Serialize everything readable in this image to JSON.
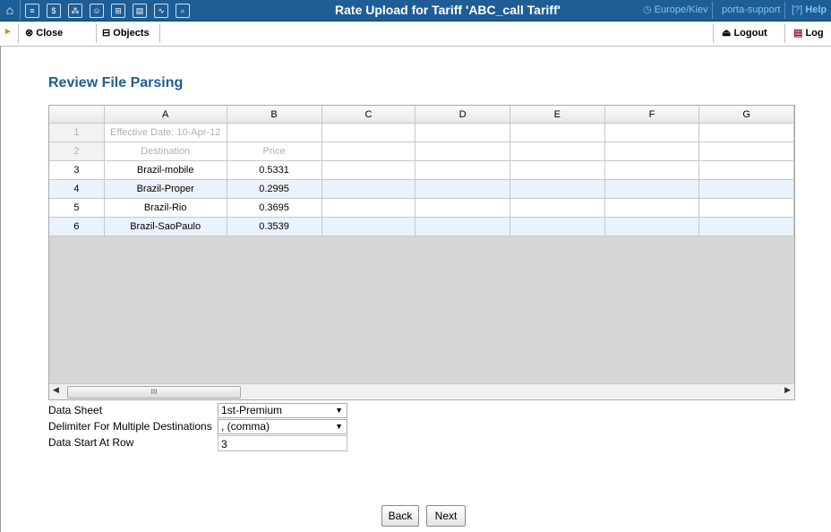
{
  "header": {
    "title": "Rate Upload for Tariff 'ABC_call Tariff'",
    "timezone": "Europe/Kiev",
    "user": "porta-support",
    "help": "Help",
    "icons": [
      "home-icon",
      "list-icon",
      "dollar-icon",
      "network-icon",
      "person-icon",
      "grid-icon",
      "report-icon",
      "chart-icon",
      "search-icon"
    ]
  },
  "toolbar": {
    "close": "Close",
    "objects": "Objects",
    "logout": "Logout",
    "log": "Log"
  },
  "page": {
    "heading": "Review File Parsing"
  },
  "grid": {
    "columns": [
      "",
      "A",
      "B",
      "C",
      "D",
      "E",
      "F",
      "G"
    ],
    "rows": [
      [
        "1",
        "Effective Date: 10-Apr-12",
        "",
        "",
        "",
        "",
        "",
        ""
      ],
      [
        "2",
        "Destination",
        "Price",
        "",
        "",
        "",
        "",
        ""
      ],
      [
        "3",
        "Brazil-mobile",
        "0.5331",
        "",
        "",
        "",
        "",
        ""
      ],
      [
        "4",
        "Brazil-Proper",
        "0.2995",
        "",
        "",
        "",
        "",
        ""
      ],
      [
        "5",
        "Brazil-Rio",
        "0.3695",
        "",
        "",
        "",
        "",
        ""
      ],
      [
        "6",
        "Brazil-SaoPaulo",
        "0.3539",
        "",
        "",
        "",
        "",
        ""
      ]
    ],
    "scroll_thumb": "III"
  },
  "form": {
    "data_sheet_label": "Data Sheet",
    "data_sheet_value": "1st-Premium",
    "delimiter_label": "Delimiter For Multiple Destinations",
    "delimiter_value": ", (comma)",
    "start_row_label": "Data Start At Row",
    "start_row_value": "3"
  },
  "buttons": {
    "back": "Back",
    "next": "Next"
  },
  "colors": {
    "header_bg": "#1f5d96",
    "heading": "#1f5d96",
    "link": "#7fc4ff",
    "accent": "#e0811e"
  }
}
